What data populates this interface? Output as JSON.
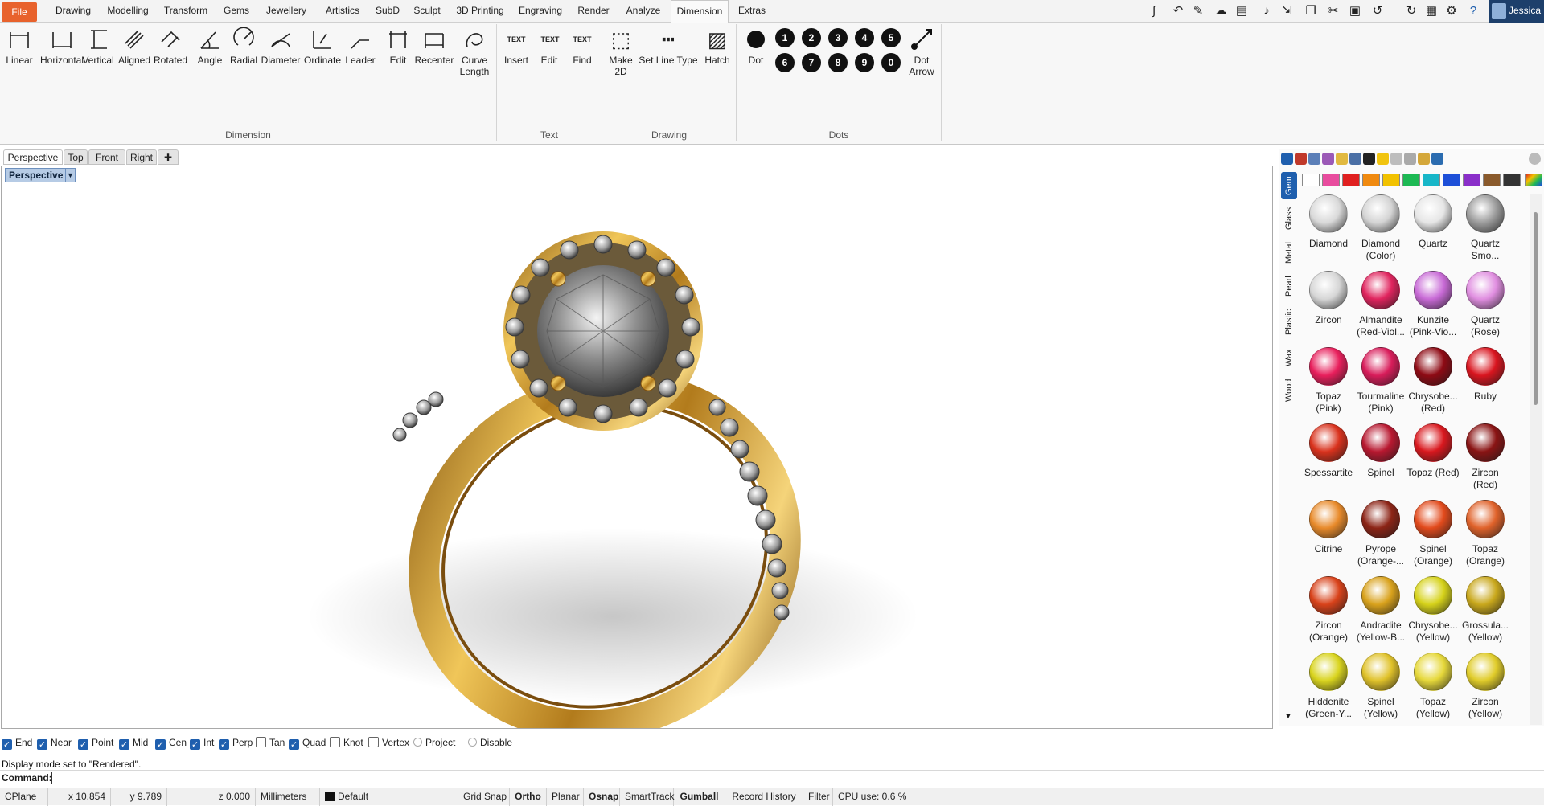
{
  "menu": {
    "tabs": [
      "File",
      "Drawing",
      "Modelling",
      "Transform",
      "Gems",
      "Jewellery",
      "Artistics",
      "SubD",
      "Sculpt",
      "3D Printing",
      "Engraving",
      "Render",
      "Analyze",
      "Dimension",
      "Extras"
    ],
    "active_tab": "Dimension",
    "user_name": "Jessica"
  },
  "ribbon": {
    "groups": {
      "dimension": "Dimension",
      "text": "Text",
      "drawing": "Drawing",
      "dots": "Dots"
    },
    "dimension_tools": [
      "Linear",
      "Horizontal",
      "Vertical",
      "Aligned",
      "Rotated",
      "Angle",
      "Radial",
      "Diameter",
      "Ordinate",
      "Leader",
      "Edit",
      "Recenter",
      "Curve\nLength"
    ],
    "text_tools": [
      "Insert",
      "Edit",
      "Find"
    ],
    "drawing_tools": [
      "Make\n2D",
      "Set Line Type",
      "Hatch"
    ],
    "dot_tools": {
      "dot": "Dot",
      "numbers_row1": [
        "1",
        "2",
        "3",
        "4",
        "5"
      ],
      "numbers_row2": [
        "6",
        "7",
        "8",
        "9",
        "0"
      ],
      "dot_arrow": "Dot\nArrow"
    },
    "text_icon_caption": "TEXT"
  },
  "viewport": {
    "tabs": [
      "Perspective",
      "Top",
      "Front",
      "Right"
    ],
    "active": "Perspective",
    "title": "Perspective"
  },
  "materials": {
    "categories": [
      "Gem",
      "Glass",
      "Metal",
      "Pearl",
      "Plastic",
      "Wax",
      "Wood"
    ],
    "active_category": "Gem",
    "swatch_colors": [
      "#ffffff",
      "#e84c9e",
      "#e02020",
      "#f08a10",
      "#f2c200",
      "#1db954",
      "#17b6c8",
      "#1d4fd8",
      "#8a2fc9",
      "#8a5a2b",
      "#333333"
    ],
    "gems": [
      {
        "name": "Diamond",
        "color": "#d9d9d9"
      },
      {
        "name": "Diamond\n(Color)",
        "color": "#d4d4d4"
      },
      {
        "name": "Quartz",
        "color": "#e6e6e6"
      },
      {
        "name": "Quartz\nSmo...",
        "color": "#9c9c9c"
      },
      {
        "name": "Zircon",
        "color": "#d6d6d6"
      },
      {
        "name": "Almandite\n(Red-Viol...",
        "color": "#e0245e"
      },
      {
        "name": "Kunzite\n(Pink-Vio...",
        "color": "#c86ad6"
      },
      {
        "name": "Quartz\n(Rose)",
        "color": "#e08ee0"
      },
      {
        "name": "Topaz\n(Pink)",
        "color": "#e81f5c"
      },
      {
        "name": "Tourmaline\n(Pink)",
        "color": "#d81c5a"
      },
      {
        "name": "Chrysobe...\n(Red)",
        "color": "#8e0a14"
      },
      {
        "name": "Ruby",
        "color": "#d9151f"
      },
      {
        "name": "Spessartite",
        "color": "#d9321d"
      },
      {
        "name": "Spinel",
        "color": "#b81830"
      },
      {
        "name": "Topaz (Red)",
        "color": "#d9181e"
      },
      {
        "name": "Zircon\n(Red)",
        "color": "#8a1414"
      },
      {
        "name": "Citrine",
        "color": "#e88a2a"
      },
      {
        "name": "Pyrope\n(Orange-...",
        "color": "#8c2416"
      },
      {
        "name": "Spinel\n(Orange)",
        "color": "#e24a1c"
      },
      {
        "name": "Topaz\n(Orange)",
        "color": "#e0622a"
      },
      {
        "name": "Zircon\n(Orange)",
        "color": "#d8421a"
      },
      {
        "name": "Andradite\n(Yellow-B...",
        "color": "#d9a21c"
      },
      {
        "name": "Chrysobe...\n(Yellow)",
        "color": "#d6d21a"
      },
      {
        "name": "Grossula...\n(Yellow)",
        "color": "#c9a81c"
      },
      {
        "name": "Hiddenite\n(Green-Y...",
        "color": "#d9d41e"
      },
      {
        "name": "Spinel\n(Yellow)",
        "color": "#e0c22a"
      },
      {
        "name": "Topaz\n(Yellow)",
        "color": "#e6d83a"
      },
      {
        "name": "Zircon\n(Yellow)",
        "color": "#e0cc2a"
      }
    ]
  },
  "osnap": [
    {
      "label": "End",
      "state": "checked"
    },
    {
      "label": "Near",
      "state": "checked"
    },
    {
      "label": "Point",
      "state": "checked"
    },
    {
      "label": "Mid",
      "state": "checked"
    },
    {
      "label": "Cen",
      "state": "checked"
    },
    {
      "label": "Int",
      "state": "checked"
    },
    {
      "label": "Perp",
      "state": "checked"
    },
    {
      "label": "Tan",
      "state": "unchecked"
    },
    {
      "label": "Quad",
      "state": "checked"
    },
    {
      "label": "Knot",
      "state": "unchecked"
    },
    {
      "label": "Vertex",
      "state": "unchecked"
    },
    {
      "label": "Project",
      "state": "radio"
    },
    {
      "label": "Disable",
      "state": "radio"
    }
  ],
  "command": {
    "history": "Display mode set to \"Rendered\".",
    "label": "Command:",
    "value": ""
  },
  "status": {
    "cplane": "CPlane",
    "x": "x 10.854",
    "y": "y 9.789",
    "z": "z 0.000",
    "units": "Millimeters",
    "layer": "Default",
    "toggles": [
      "Grid Snap",
      "Ortho",
      "Planar",
      "Osnap",
      "SmartTrack",
      "Gumball",
      "Record History",
      "Filter"
    ],
    "active_toggles": [
      "Ortho",
      "Osnap",
      "Gumball"
    ],
    "cpu": "CPU use: 0.6 %"
  },
  "colors": {
    "file_tab": "#e8622c",
    "accent": "#1f5fae",
    "metal_gold": "#d4a73a"
  }
}
